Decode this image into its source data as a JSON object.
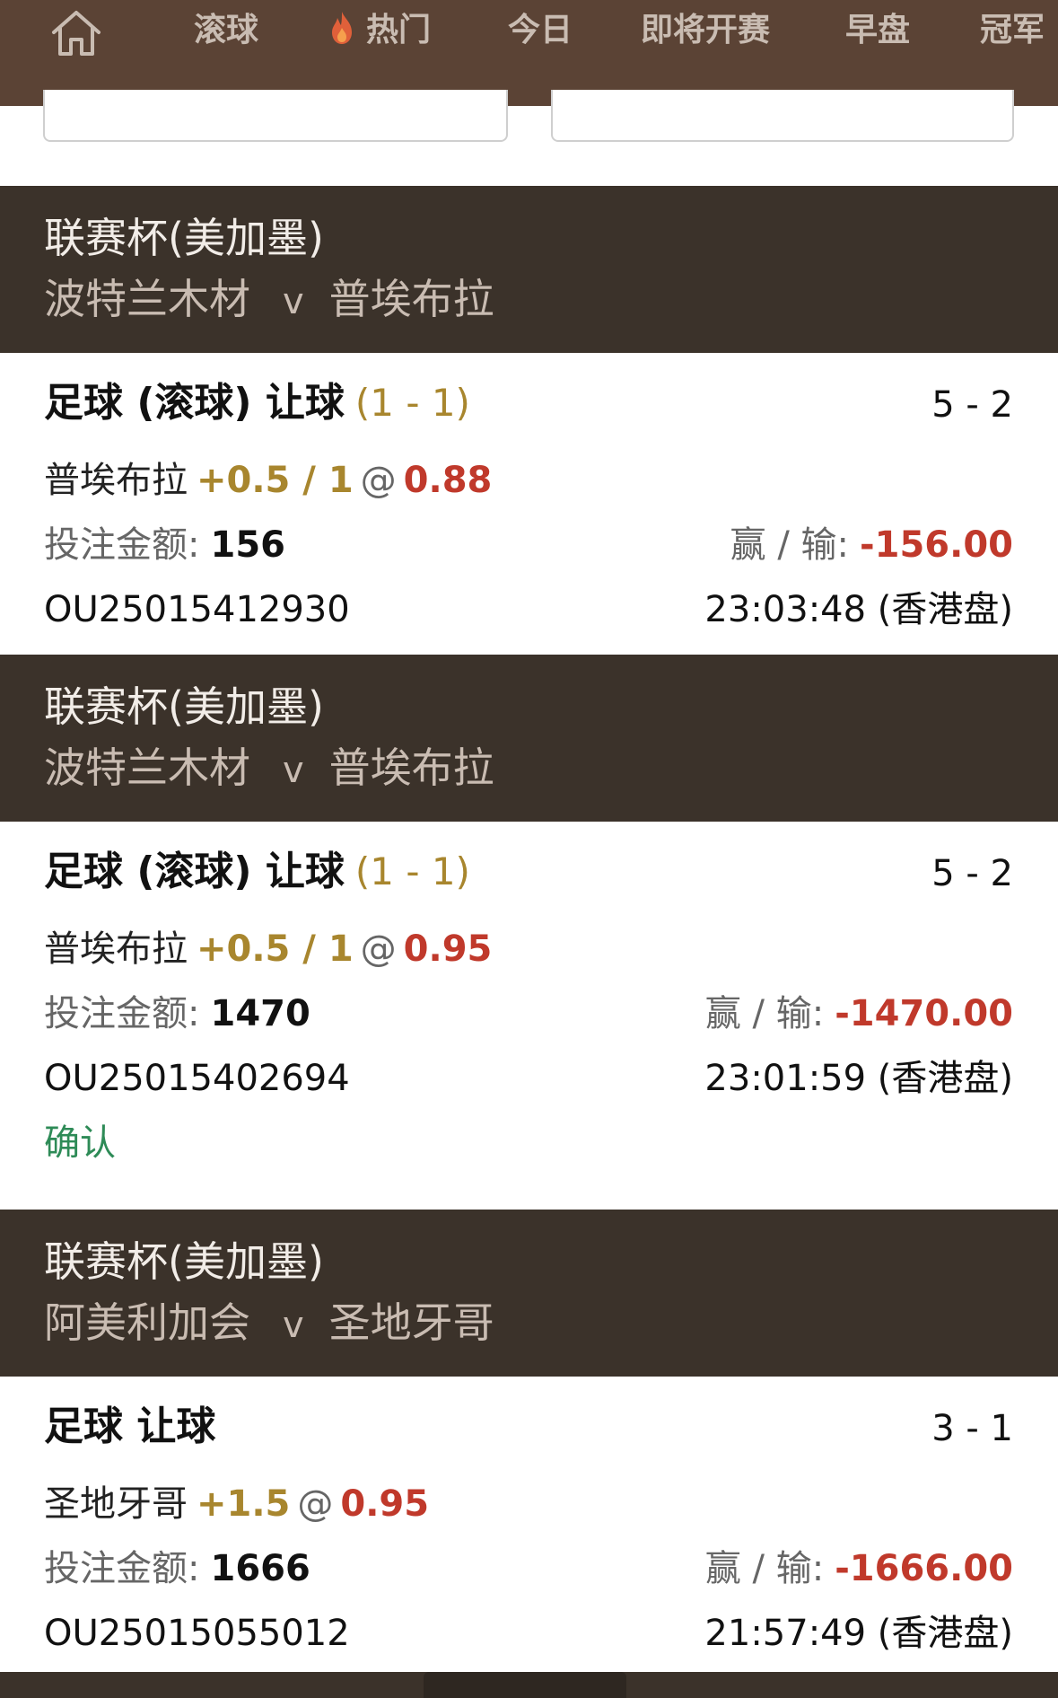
{
  "nav": {
    "home_icon": "home-icon",
    "items": [
      {
        "label": "滚球"
      },
      {
        "label": "热门",
        "icon": "flame-icon"
      },
      {
        "label": "今日"
      },
      {
        "label": "即将开赛"
      },
      {
        "label": "早盘"
      },
      {
        "label": "冠军"
      }
    ]
  },
  "bets": [
    {
      "league": "联赛杯(美加墨)",
      "home": "波特兰木材",
      "vs": "v",
      "away": "普埃布拉",
      "market": "足球 (滚球) 让球",
      "live_score": "(1 - 1)",
      "score": "5 - 2",
      "selection": "普埃布拉",
      "handicap": "+0.5 / 1",
      "at": "@",
      "odds": "0.88",
      "stake_label": "投注金额:",
      "stake": "156",
      "winloss_label": "赢 / 输:",
      "winloss": "-156.00",
      "ref": "OU25015412930",
      "time": "23:03:48 (香港盘)"
    },
    {
      "league": "联赛杯(美加墨)",
      "home": "波特兰木材",
      "vs": "v",
      "away": "普埃布拉",
      "market": "足球 (滚球) 让球",
      "live_score": "(1 - 1)",
      "score": "5 - 2",
      "selection": "普埃布拉",
      "handicap": "+0.5 / 1",
      "at": "@",
      "odds": "0.95",
      "stake_label": "投注金额:",
      "stake": "1470",
      "winloss_label": "赢 / 输:",
      "winloss": "-1470.00",
      "ref": "OU25015402694",
      "time": "23:01:59 (香港盘)",
      "status": "确认"
    },
    {
      "league": "联赛杯(美加墨)",
      "home": "阿美利加会",
      "vs": "v",
      "away": "圣地牙哥",
      "market": "足球 让球",
      "score": "3 - 1",
      "selection": "圣地牙哥",
      "handicap": "+1.5",
      "at": "@",
      "odds": "0.95",
      "stake_label": "投注金额:",
      "stake": "1666",
      "winloss_label": "赢 / 输:",
      "winloss": "-1666.00",
      "ref": "OU25015055012",
      "time": "21:57:49 (香港盘)"
    }
  ],
  "colors": {
    "nav_bg": "#5b4335",
    "league_bg": "#3b322a",
    "handicap": "#a8862e",
    "negative": "#c0392b",
    "confirmed": "#2e8b57"
  }
}
